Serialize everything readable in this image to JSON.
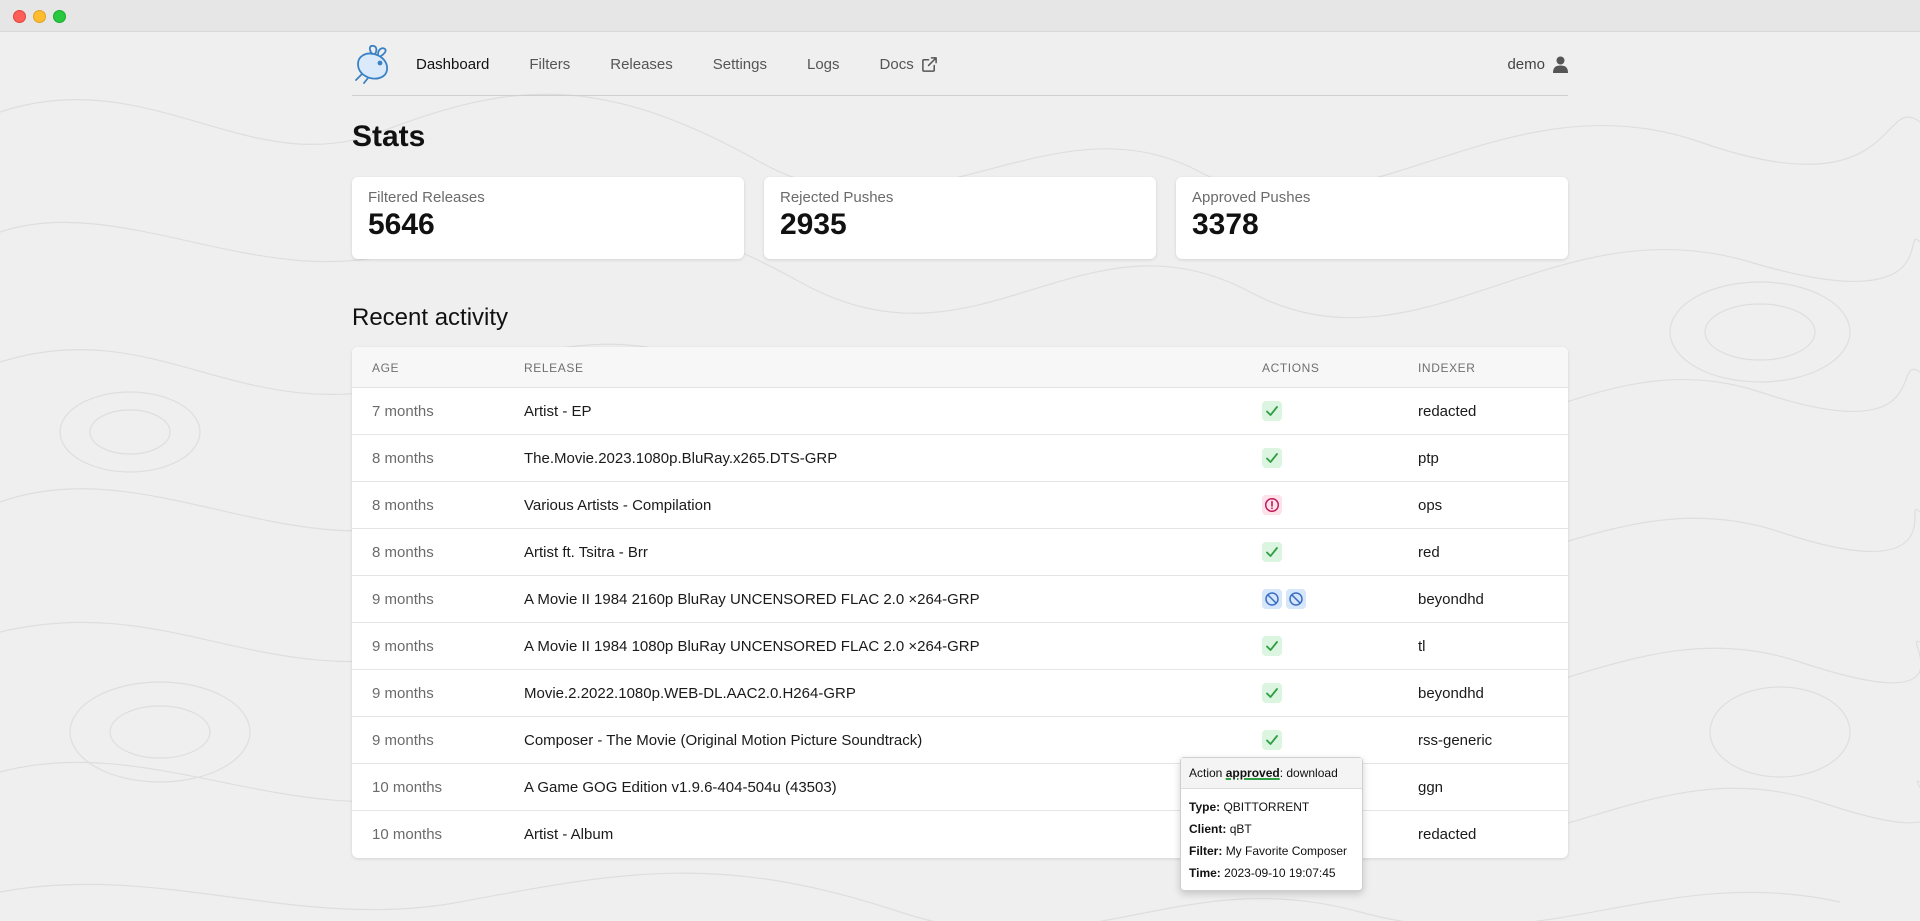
{
  "nav": {
    "links": [
      "Dashboard",
      "Filters",
      "Releases",
      "Settings",
      "Logs",
      "Docs"
    ],
    "active": "Dashboard",
    "user": "demo"
  },
  "stats": {
    "title": "Stats",
    "cards": [
      {
        "label": "Filtered Releases",
        "value": "5646"
      },
      {
        "label": "Rejected Pushes",
        "value": "2935"
      },
      {
        "label": "Approved Pushes",
        "value": "3378"
      }
    ]
  },
  "recent": {
    "title": "Recent activity",
    "columns": [
      "AGE",
      "RELEASE",
      "ACTIONS",
      "INDEXER"
    ],
    "rows": [
      {
        "age": "7 months",
        "release": "Artist - EP",
        "actions": [
          "approved"
        ],
        "indexer": "redacted"
      },
      {
        "age": "8 months",
        "release": "The.Movie.2023.1080p.BluRay.x265.DTS-GRP",
        "actions": [
          "approved"
        ],
        "indexer": "ptp"
      },
      {
        "age": "8 months",
        "release": "Various Artists - Compilation",
        "actions": [
          "rejected"
        ],
        "indexer": "ops"
      },
      {
        "age": "8 months",
        "release": "Artist ft. Tsitra - Brr",
        "actions": [
          "approved"
        ],
        "indexer": "red"
      },
      {
        "age": "9 months",
        "release": "A Movie II 1984 2160p BluRay UNCENSORED FLAC 2.0 ×264-GRP",
        "actions": [
          "pending",
          "pending"
        ],
        "indexer": "beyondhd"
      },
      {
        "age": "9 months",
        "release": "A Movie II 1984 1080p BluRay UNCENSORED FLAC 2.0 ×264-GRP",
        "actions": [
          "approved"
        ],
        "indexer": "tl"
      },
      {
        "age": "9 months",
        "release": "Movie.2.2022.1080p.WEB-DL.AAC2.0.H264-GRP",
        "actions": [
          "approved"
        ],
        "indexer": "beyondhd"
      },
      {
        "age": "9 months",
        "release": "Composer - The Movie (Original Motion Picture Soundtrack)",
        "actions": [
          "approved"
        ],
        "indexer": "rss-generic"
      },
      {
        "age": "10 months",
        "release": "A Game GOG Edition v1.9.6-404-504u (43503)",
        "actions": [],
        "indexer": "ggn"
      },
      {
        "age": "10 months",
        "release": "Artist - Album",
        "actions": [],
        "indexer": "redacted"
      }
    ]
  },
  "tooltip": {
    "prefix": "Action ",
    "status": "approved",
    "suffix": ": download",
    "type_label": "Type:",
    "type": "QBITTORRENT",
    "client_label": "Client:",
    "client": "qBT",
    "filter_label": "Filter:",
    "filter": "My Favorite Composer",
    "time_label": "Time:",
    "time": "2023-09-10 19:07:45"
  },
  "icons": {
    "approved": "check-icon",
    "rejected": "alert-circle-icon",
    "pending": "ban-icon",
    "docs_external": "external-link-icon",
    "user": "user-icon",
    "logo": "rabbit-logo"
  },
  "colors": {
    "approved_bg": "#dcf5e0",
    "approved_fg": "#2f9e44",
    "rejected_bg": "#fde2ea",
    "rejected_fg": "#c2185b",
    "pending_bg": "#d6e6fb",
    "pending_fg": "#3b6fc4"
  }
}
